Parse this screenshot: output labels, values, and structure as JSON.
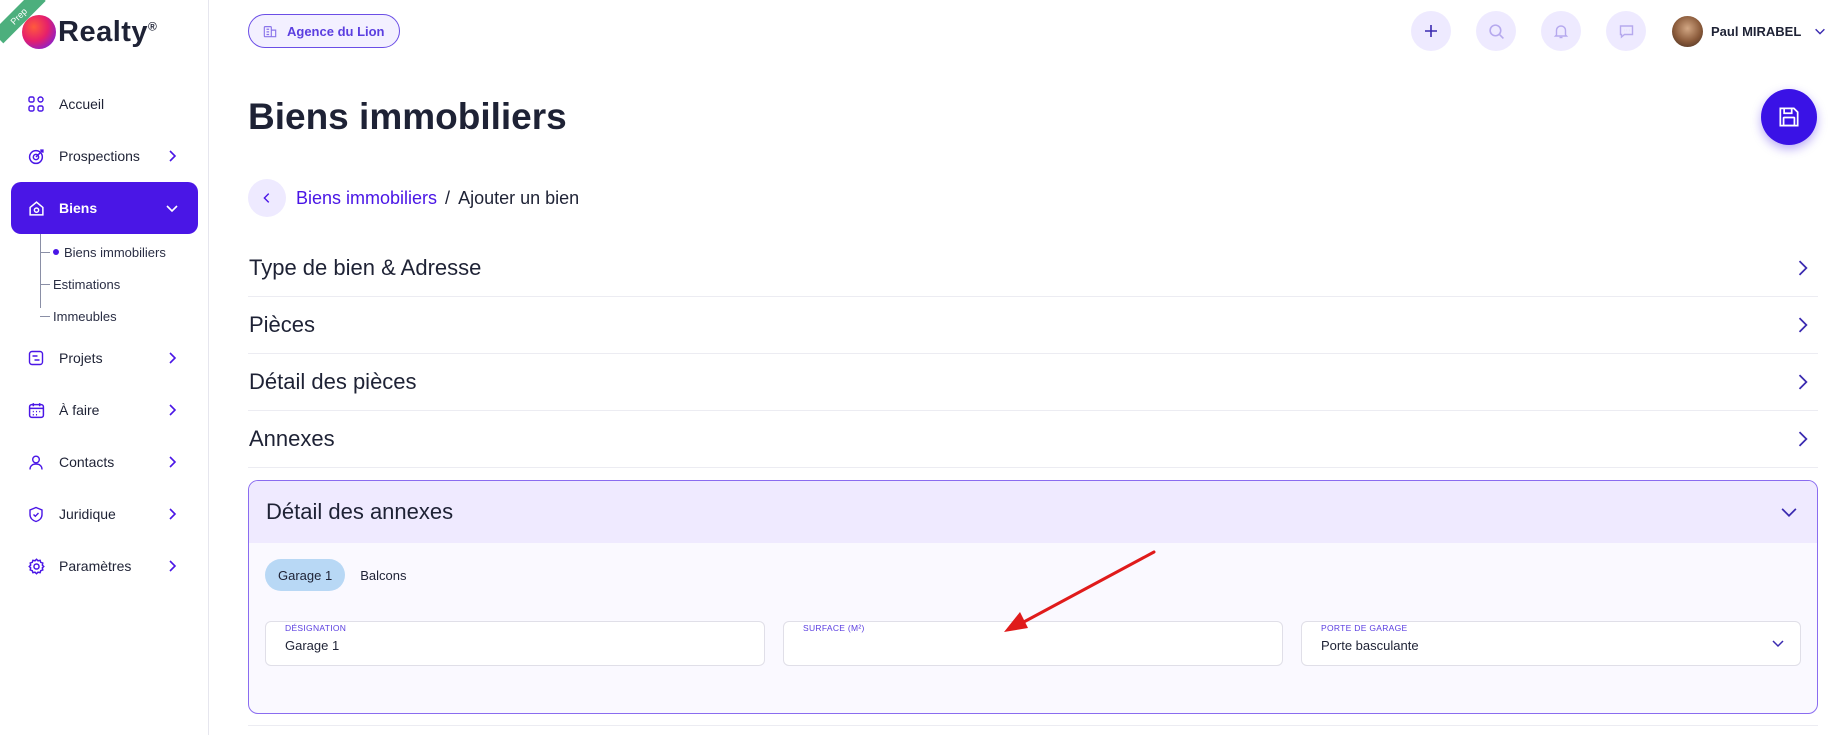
{
  "app": {
    "logo_text": "Realty",
    "logo_mark": "®",
    "env_badge": "Prep"
  },
  "sidebar": {
    "items": [
      {
        "label": "Accueil",
        "icon": "grid-icon"
      },
      {
        "label": "Prospections",
        "icon": "target-icon"
      },
      {
        "label": "Biens",
        "icon": "home-icon",
        "active": true
      },
      {
        "label": "Projets",
        "icon": "kanban-icon"
      },
      {
        "label": "À faire",
        "icon": "calendar-icon"
      },
      {
        "label": "Contacts",
        "icon": "user-icon"
      },
      {
        "label": "Juridique",
        "icon": "shield-icon"
      },
      {
        "label": "Paramètres",
        "icon": "gear-icon"
      }
    ],
    "sub_items": [
      {
        "label": "Biens immobiliers",
        "active": true
      },
      {
        "label": "Estimations"
      },
      {
        "label": "Immeubles"
      }
    ]
  },
  "topbar": {
    "agency": "Agence du Lion",
    "user_name": "Paul MIRABEL"
  },
  "page": {
    "title": "Biens immobiliers",
    "breadcrumb_link": "Biens immobiliers",
    "breadcrumb_sep": "/",
    "breadcrumb_current": "Ajouter un bien"
  },
  "sections": [
    {
      "label": "Type de bien & Adresse"
    },
    {
      "label": "Pièces"
    },
    {
      "label": "Détail des pièces"
    },
    {
      "label": "Annexes"
    }
  ],
  "panel": {
    "title": "Détail des annexes",
    "tabs": [
      {
        "label": "Garage 1",
        "active": true
      },
      {
        "label": "Balcons"
      }
    ],
    "fields": {
      "designation": {
        "label": "DÉSIGNATION",
        "value": "Garage 1"
      },
      "surface": {
        "label": "SURFACE (M²)",
        "value": ""
      },
      "door": {
        "label": "PORTE DE GARAGE",
        "value": "Porte basculante"
      }
    }
  },
  "colors": {
    "accent": "#4a16e6",
    "accent_soft": "#eeeaff",
    "annotation_arrow": "#e01b1b"
  }
}
